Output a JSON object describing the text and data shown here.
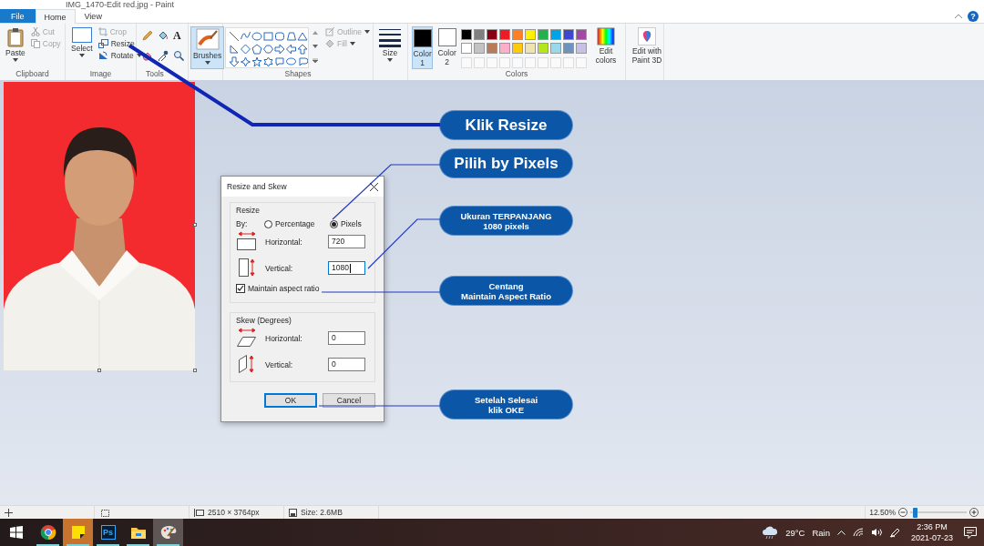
{
  "window": {
    "title": "IMG_1470-Edit red.jpg - Paint",
    "help": "?"
  },
  "tabs": [
    {
      "label": "File",
      "kind": "file",
      "selected": false
    },
    {
      "label": "Home",
      "kind": "tab",
      "selected": true
    },
    {
      "label": "View",
      "kind": "tab",
      "selected": false
    }
  ],
  "ribbon": {
    "clipboard": {
      "label": "Clipboard",
      "paste": "Paste",
      "items": [
        {
          "label": "Cut",
          "kind": "cut",
          "disabled": true
        },
        {
          "label": "Copy",
          "kind": "copy",
          "disabled": true
        }
      ]
    },
    "image": {
      "label": "Image",
      "select": "Select",
      "items": [
        {
          "label": "Crop",
          "kind": "crop",
          "disabled": true
        },
        {
          "label": "Resize",
          "kind": "resize",
          "disabled": false
        },
        {
          "label": "Rotate",
          "kind": "rotate",
          "disabled": false
        }
      ]
    },
    "tools": {
      "label": "Tools",
      "text_tool": "A"
    },
    "brushes": {
      "label": "Brushes",
      "selected": true
    },
    "shapes": {
      "label": "Shapes",
      "outline": "Outline",
      "fill": "Fill"
    },
    "size": {
      "label": "Size"
    },
    "colors": {
      "label": "Colors",
      "color1": {
        "label": "Color 1",
        "color": "#000000",
        "selected": true
      },
      "color2": {
        "label": "Color 2",
        "color": "#ffffff",
        "selected": false
      },
      "palette": [
        {
          "color": "#000000"
        },
        {
          "color": "#7f7f7f"
        },
        {
          "color": "#880015"
        },
        {
          "color": "#ed1c24"
        },
        {
          "color": "#ff7f27"
        },
        {
          "color": "#fff200"
        },
        {
          "color": "#22b14c"
        },
        {
          "color": "#00a2e8"
        },
        {
          "color": "#3f48cc"
        },
        {
          "color": "#a349a4"
        },
        {
          "color": "#ffffff"
        },
        {
          "color": "#c3c3c3"
        },
        {
          "color": "#b97a57"
        },
        {
          "color": "#ffaec9"
        },
        {
          "color": "#ffc90e"
        },
        {
          "color": "#efe4b0"
        },
        {
          "color": "#b5e61d"
        },
        {
          "color": "#99d9ea"
        },
        {
          "color": "#7092be"
        },
        {
          "color": "#c8bfe7"
        }
      ],
      "edit": "Edit colors"
    },
    "paint3d": {
      "label": "Edit with Paint 3D"
    }
  },
  "canvas": {
    "dialog": {
      "title": "Resize and Skew",
      "resize": {
        "label": "Resize",
        "by": "By:",
        "options": [
          {
            "label": "Percentage",
            "selected": false
          },
          {
            "label": "Pixels",
            "selected": true
          }
        ],
        "fields": [
          {
            "label": "Horizontal:",
            "value": "720",
            "kind": "horizontal",
            "focused": false
          },
          {
            "label": "Vertical:",
            "value": "1080",
            "kind": "vertical",
            "focused": true
          }
        ],
        "maintain": {
          "label": "Maintain aspect ratio",
          "checked": true
        }
      },
      "skew": {
        "label": "Skew (Degrees)",
        "fields": [
          {
            "label": "Horizontal:",
            "value": "0",
            "kind": "horizontal",
            "focused": false
          },
          {
            "label": "Vertical:",
            "value": "0",
            "kind": "vertical",
            "focused": false
          }
        ]
      },
      "buttons": [
        {
          "label": "OK",
          "default": true
        },
        {
          "label": "Cancel",
          "default": false
        }
      ]
    },
    "callouts": [
      {
        "text": "Klik Resize",
        "kind": "large"
      },
      {
        "text": "Pilih by Pixels",
        "kind": "large"
      },
      {
        "text": "Ukuran TERPANJANG\n1080 pixels",
        "kind": "small"
      },
      {
        "text": "Centang\nMaintain Aspect Ratio",
        "kind": "small"
      },
      {
        "text": "Setelah Selesai\nklik OKE",
        "kind": "small"
      }
    ]
  },
  "status_bar": {
    "dimensions": "2510 × 3764px",
    "size": "Size: 2.6MB",
    "zoom": "12.50%",
    "zoom_slider": {
      "level": 0.08
    }
  },
  "taskbar": {
    "apps": [
      {
        "kind": "chrome",
        "selected": false,
        "running": true
      },
      {
        "kind": "sticky-notes",
        "selected": false,
        "running": true
      },
      {
        "kind": "photoshop",
        "label": "Ps",
        "selected": false,
        "running": true
      },
      {
        "kind": "explorer",
        "selected": false,
        "running": true
      },
      {
        "kind": "paint",
        "selected": true,
        "running": true
      }
    ],
    "weather": {
      "temp": "29°C",
      "condition": "Rain"
    },
    "time": "2:36 PM",
    "date": "2021-07-23"
  }
}
